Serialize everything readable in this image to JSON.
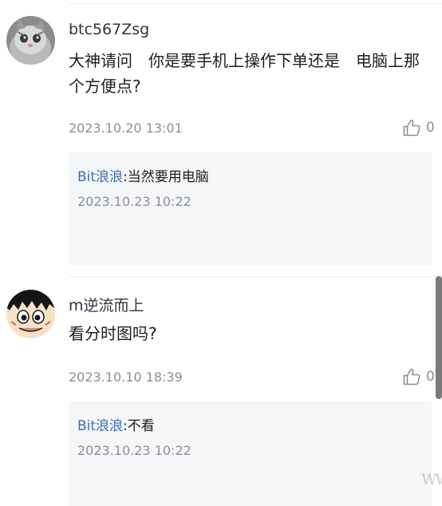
{
  "comments": [
    {
      "username": "btc567Zsg",
      "avatar": "cat-avatar",
      "text": "大神请问　你是要手机上操作下单还是　电脑上那个方便点?",
      "timestamp": "2023.10.20 13:01",
      "likes": "0",
      "reply": {
        "author": "Bit浪浪",
        "separator": ":",
        "text": "当然要用电脑",
        "timestamp": "2023.10.23 10:22"
      }
    },
    {
      "username": "m逆流而上",
      "avatar": "cartoon-avatar",
      "text": "看分时图吗?",
      "timestamp": "2023.10.10 18:39",
      "likes": "0",
      "reply": {
        "author": "Bit浪浪",
        "separator": ":",
        "text": "不看",
        "timestamp": "2023.10.23 10:22"
      }
    }
  ],
  "icons": {
    "like": "thumbs-up-icon"
  },
  "colors": {
    "reply_author": "#3b6fb6",
    "timestamp": "#8a8f99",
    "reply_background": "#f5f6f8"
  }
}
